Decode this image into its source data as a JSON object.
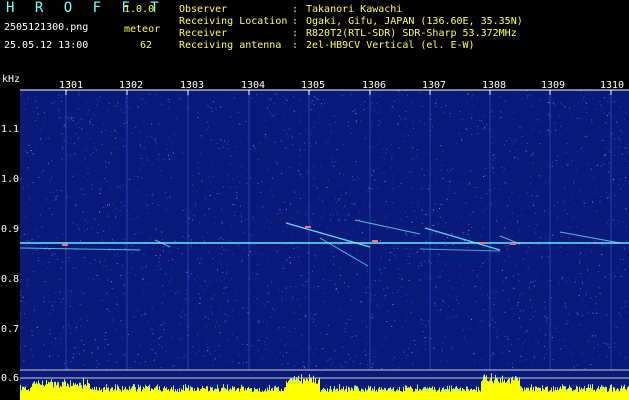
{
  "header": {
    "app_name": "H R O F F T",
    "version": "1.0.0",
    "file_name": "2505121300.png",
    "meteor_label": "meteor",
    "datetime": "25.05.12 13:00",
    "meteor_count": "62",
    "info": [
      {
        "key": "Observer",
        "value": "Takanori Kawachi"
      },
      {
        "key": "Receiving Location",
        "value": "Ogaki, Gifu, JAPAN (136.60E, 35.35N)"
      },
      {
        "key": "Receiver",
        "value": "R820T2(RTL-SDR) SDR-Sharp 53.372MHz"
      },
      {
        "key": "Receiving antenna",
        "value": "2el-HB9CV Vertical (el. E-W)"
      }
    ],
    "separator": ":"
  },
  "plot": {
    "y_unit": "kHz",
    "time_ticks": [
      "1301",
      "1302",
      "1303",
      "1304",
      "1305",
      "1306",
      "1307",
      "1308",
      "1309",
      "1310"
    ],
    "freq_ticks": [
      "1.1",
      "1.0",
      "0.9",
      "0.8",
      "0.7",
      "0.6"
    ],
    "colors": {
      "background": "#0a1a7a",
      "noise": "#3b6cff",
      "trace": "#7ff",
      "baseline": "#ffffff",
      "signal_bar": "#ffff00"
    }
  }
}
